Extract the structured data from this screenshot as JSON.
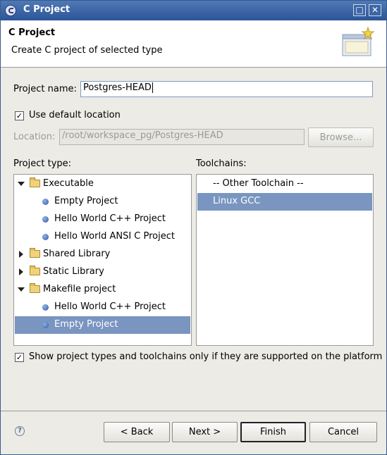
{
  "window": {
    "title": "C Project"
  },
  "header": {
    "title": "C Project",
    "description": "Create C project of selected type"
  },
  "project_name": {
    "label": "Project name:",
    "value": "Postgres-HEAD"
  },
  "use_default_location": {
    "label": "Use default location",
    "checked": true
  },
  "location": {
    "label": "Location:",
    "value": "/root/workspace_pg/Postgres-HEAD",
    "browse_label": "Browse..."
  },
  "project_type": {
    "label": "Project type:",
    "items": [
      {
        "label": "Executable",
        "kind": "folder",
        "expanded": true,
        "level": 0
      },
      {
        "label": "Empty Project",
        "kind": "leaf",
        "level": 1
      },
      {
        "label": "Hello World C++ Project",
        "kind": "leaf",
        "level": 1
      },
      {
        "label": "Hello World ANSI C Project",
        "kind": "leaf",
        "level": 1
      },
      {
        "label": "Shared Library",
        "kind": "folder",
        "expanded": false,
        "level": 0
      },
      {
        "label": "Static Library",
        "kind": "folder",
        "expanded": false,
        "level": 0
      },
      {
        "label": "Makefile project",
        "kind": "folder",
        "expanded": true,
        "level": 0
      },
      {
        "label": "Hello World C++ Project",
        "kind": "leaf",
        "level": 1
      },
      {
        "label": "Empty Project",
        "kind": "leaf",
        "level": 1,
        "selected": true
      }
    ]
  },
  "toolchains": {
    "label": "Toolchains:",
    "items": [
      {
        "label": "-- Other Toolchain --"
      },
      {
        "label": "Linux GCC",
        "selected": true
      }
    ]
  },
  "show_supported": {
    "label": "Show project types and toolchains only if they are supported on the platform",
    "checked": true
  },
  "buttons": {
    "back": "< Back",
    "next": "Next >",
    "finish": "Finish",
    "cancel": "Cancel"
  },
  "colors": {
    "titlebar": "#2b5596",
    "selection": "#7995c0",
    "dialog_bg": "#ecebe6"
  }
}
